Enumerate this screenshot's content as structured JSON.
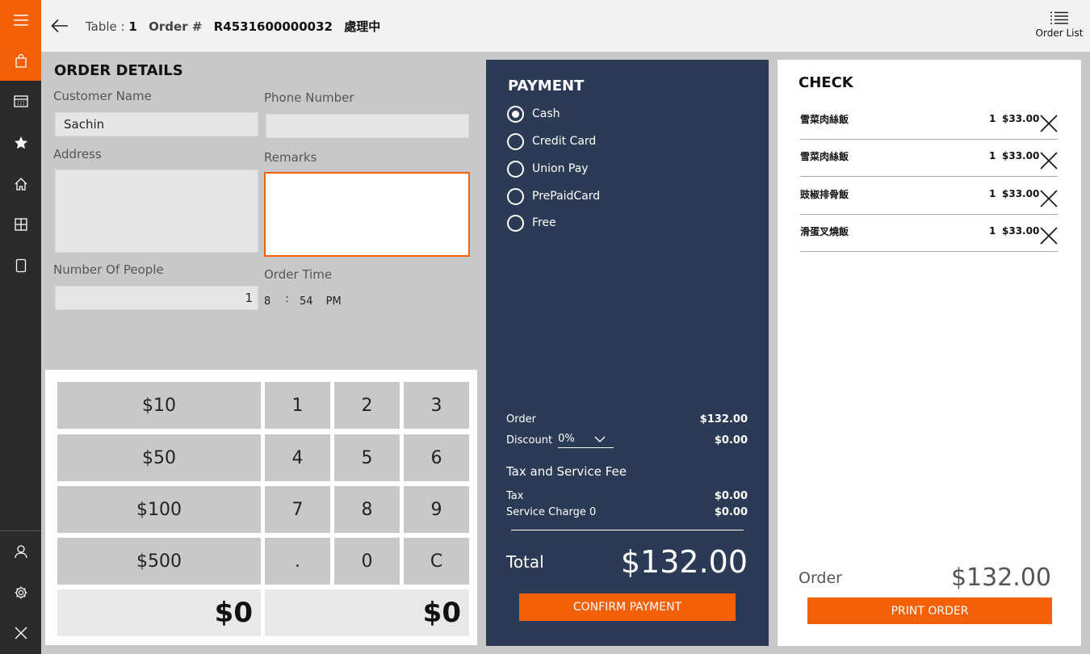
{
  "header": {
    "table_label": "Table :",
    "table_value": "1",
    "order_label": "Order #",
    "order_number": "R4531600000032",
    "status": "處理中",
    "order_list_label": "Order List"
  },
  "order_details": {
    "title": "ORDER DETAILS",
    "customer_name_label": "Customer Name",
    "customer_name_value": "Sachin",
    "phone_label": "Phone Number",
    "phone_value": "",
    "address_label": "Address",
    "address_value": "",
    "remarks_label": "Remarks",
    "remarks_value": "",
    "people_label": "Number Of People",
    "people_value": "1",
    "order_time_label": "Order Time",
    "order_time_hour": "8",
    "order_time_sep": ":",
    "order_time_minute": "54",
    "order_time_ampm": "PM"
  },
  "keypad": {
    "quick_amounts": [
      "$10",
      "$50",
      "$100",
      "$500"
    ],
    "keys": [
      "1",
      "2",
      "3",
      "4",
      "5",
      "6",
      "7",
      "8",
      "9",
      ".",
      "0",
      "C"
    ],
    "amount_left": "$0",
    "amount_right": "$0"
  },
  "payment": {
    "title": "PAYMENT",
    "methods": [
      "Cash",
      "Credit Card",
      "Union Pay",
      "PrePaidCard",
      "Free"
    ],
    "selected_method": "Cash",
    "order_label": "Order",
    "order_value": "$132.00",
    "discount_label": "Discount",
    "discount_option": "0%",
    "discount_value": "$0.00",
    "tax_service_heading": "Tax and Service Fee",
    "tax_label": "Tax",
    "tax_value": "$0.00",
    "service_charge_label": "Service Charge 0",
    "service_charge_value": "$0.00",
    "total_label": "Total",
    "total_value": "$132.00",
    "confirm_label": "CONFIRM PAYMENT"
  },
  "check": {
    "title": "CHECK",
    "items": [
      {
        "name": "雪菜肉絲飯",
        "qty": "1",
        "price": "$33.00"
      },
      {
        "name": "雪菜肉絲飯",
        "qty": "1",
        "price": "$33.00"
      },
      {
        "name": "豉椒排骨飯",
        "qty": "1",
        "price": "$33.00"
      },
      {
        "name": "滑蛋叉燒飯",
        "qty": "1",
        "price": "$33.00"
      }
    ],
    "order_label": "Order",
    "order_value": "$132.00",
    "print_label": "PRINT ORDER"
  },
  "colors": {
    "accent": "#f46006",
    "sidebar": "#2b2b2b",
    "payment_panel": "#2c3b55",
    "panel_bg": "#c8c8c8"
  },
  "icons": {
    "sidebar_top": [
      "hamburger-menu-icon",
      "shopping-bag-icon",
      "calendar-icon",
      "star-icon",
      "home-icon",
      "grid-icon",
      "tablet-icon"
    ],
    "sidebar_bottom": [
      "user-icon",
      "gear-icon",
      "close-icon"
    ],
    "header": [
      "back-arrow-icon",
      "list-icon"
    ],
    "check_item": "remove-x-icon"
  }
}
